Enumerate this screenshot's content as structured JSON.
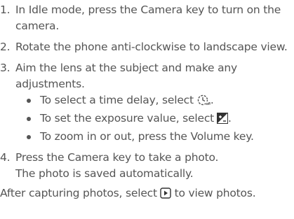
{
  "steps": [
    {
      "num": "1.",
      "text": "In Idle mode, press the Camera key to turn on the camera."
    },
    {
      "num": "2.",
      "text": "Rotate the phone anti-clockwise to landscape view."
    },
    {
      "num": "3.",
      "text": "Aim the lens at the subject and make any adjustments.",
      "sub_items": [
        {
          "text": "To select a time delay, select",
          "icon": "timer-icon",
          "end": "."
        },
        {
          "text": "To set the exposure value, select",
          "icon": "exposure-icon",
          "end": "."
        },
        {
          "text": "To zoom in or out, press the Volume key.",
          "icon": "",
          "end": ""
        }
      ]
    },
    {
      "num": "4.",
      "text": "Press the Camera key to take a photo.",
      "text2": "The photo is saved automatically."
    }
  ],
  "footer": {
    "before": "After capturing photos, select",
    "icon": "play-icon",
    "after": "to view photos."
  },
  "colors": {
    "text": "#555555"
  }
}
